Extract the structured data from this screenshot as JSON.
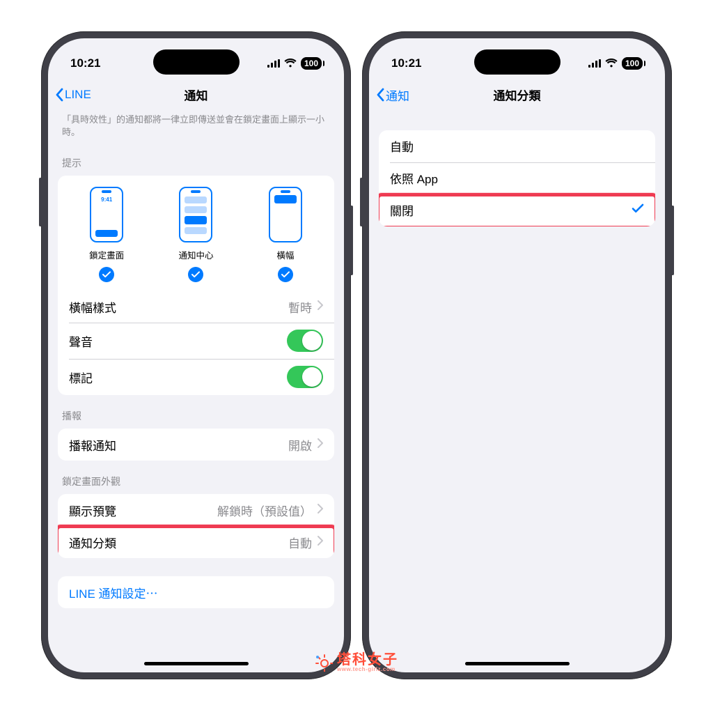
{
  "status": {
    "time": "10:21",
    "battery": "100"
  },
  "left": {
    "back": "LINE",
    "title": "通知",
    "note": "「具時效性」的通知都將一律立即傳送並會在鎖定畫面上顯示一小時。",
    "alerts_header": "提示",
    "alerts": {
      "lock": {
        "label": "鎖定畫面",
        "clock": "9:41"
      },
      "center": {
        "label": "通知中心"
      },
      "banner": {
        "label": "橫幅"
      }
    },
    "banner_style": {
      "label": "橫幅樣式",
      "value": "暫時"
    },
    "sound": "聲音",
    "badge": "標記",
    "announce_header": "播報",
    "announce": {
      "label": "播報通知",
      "value": "開啟"
    },
    "lock_appearance_header": "鎖定畫面外觀",
    "preview": {
      "label": "顯示預覽",
      "value": "解鎖時（預設值）"
    },
    "grouping": {
      "label": "通知分類",
      "value": "自動"
    },
    "line_settings": "LINE 通知設定⋯"
  },
  "right": {
    "back": "通知",
    "title": "通知分類",
    "options": {
      "auto": "自動",
      "by_app": "依照 App",
      "off": "關閉"
    }
  },
  "watermark": {
    "title": "塔科女子",
    "url": "www.tech-girlz.com"
  }
}
